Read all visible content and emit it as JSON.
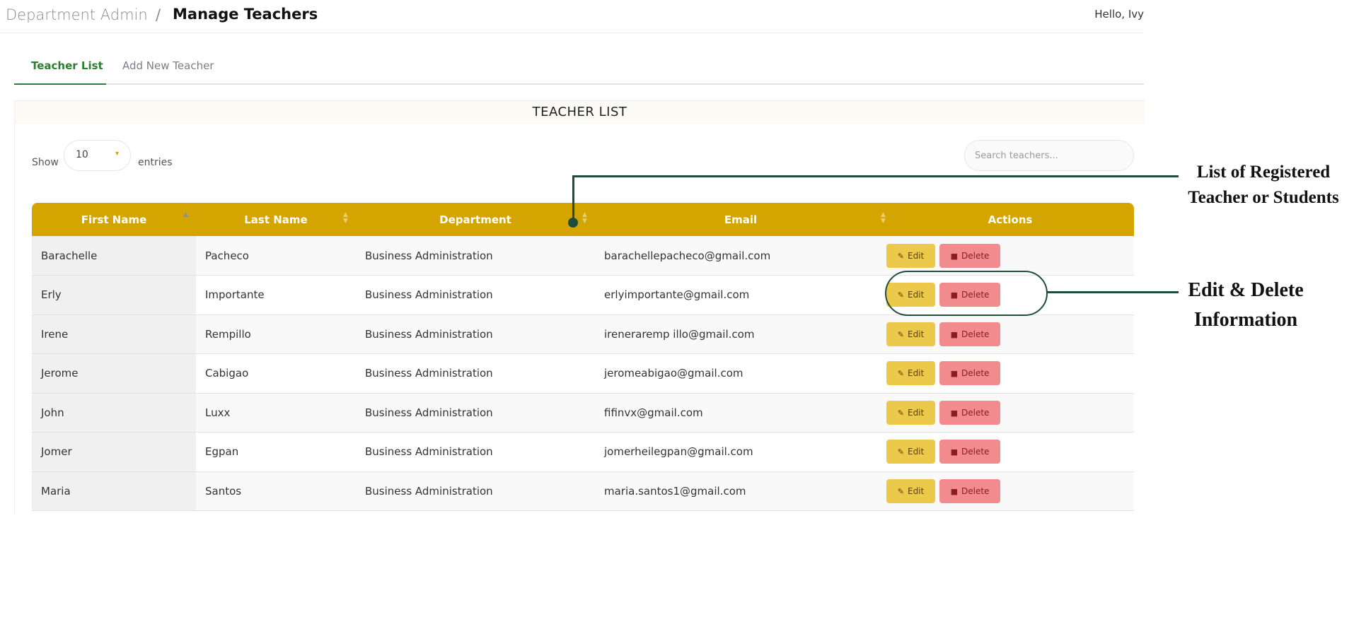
{
  "header": {
    "breadcrumb_parent": "Department Admin",
    "breadcrumb_separator": "/",
    "page_title": "Manage Teachers",
    "greeting": "Hello, Ivy"
  },
  "tabs": [
    {
      "label": "Teacher List",
      "active": true
    },
    {
      "label": "Add New Teacher",
      "active": false
    }
  ],
  "panel": {
    "title": "TEACHER LIST",
    "show_label": "Show",
    "entries_value": "10",
    "entries_label": "entries",
    "search_placeholder": "Search teachers..."
  },
  "table": {
    "columns": [
      "First Name",
      "Last Name",
      "Department",
      "Email",
      "Actions"
    ],
    "rows": [
      {
        "first": "Barachelle",
        "last": "Pacheco",
        "dept": "Business Administration",
        "email": "barachellepacheco@gmail.com"
      },
      {
        "first": "Erly",
        "last": "Importante",
        "dept": "Business Administration",
        "email": "erlyimportante@gmail.com"
      },
      {
        "first": "Irene",
        "last": "Rempillo",
        "dept": "Business Administration",
        "email": "ireneraremp illo@gmail.com"
      },
      {
        "first": "Jerome",
        "last": "Cabigao",
        "dept": "Business Administration",
        "email": "jeromeabigao@gmail.com"
      },
      {
        "first": "John",
        "last": "Luxx",
        "dept": "Business Administration",
        "email": "fifinvx@gmail.com"
      },
      {
        "first": "Jomer",
        "last": "Egpan",
        "dept": "Business Administration",
        "email": "jomerheilegpan@gmail.com"
      },
      {
        "first": "Maria",
        "last": "Santos",
        "dept": "Business Administration",
        "email": "maria.santos1@gmail.com"
      }
    ],
    "edit_label": "Edit",
    "delete_label": "Delete"
  },
  "annotations": {
    "list_line1": "List of Registered",
    "list_line2": "Teacher or Students",
    "edit_line1": "Edit & Delete",
    "edit_line2": "Information"
  },
  "colors": {
    "accent_green": "#2e7d32",
    "header_gold": "#d4a500",
    "edit_yellow": "#ecc94b",
    "delete_red": "#f28b8e",
    "annotation_green": "#1f4d3a"
  }
}
